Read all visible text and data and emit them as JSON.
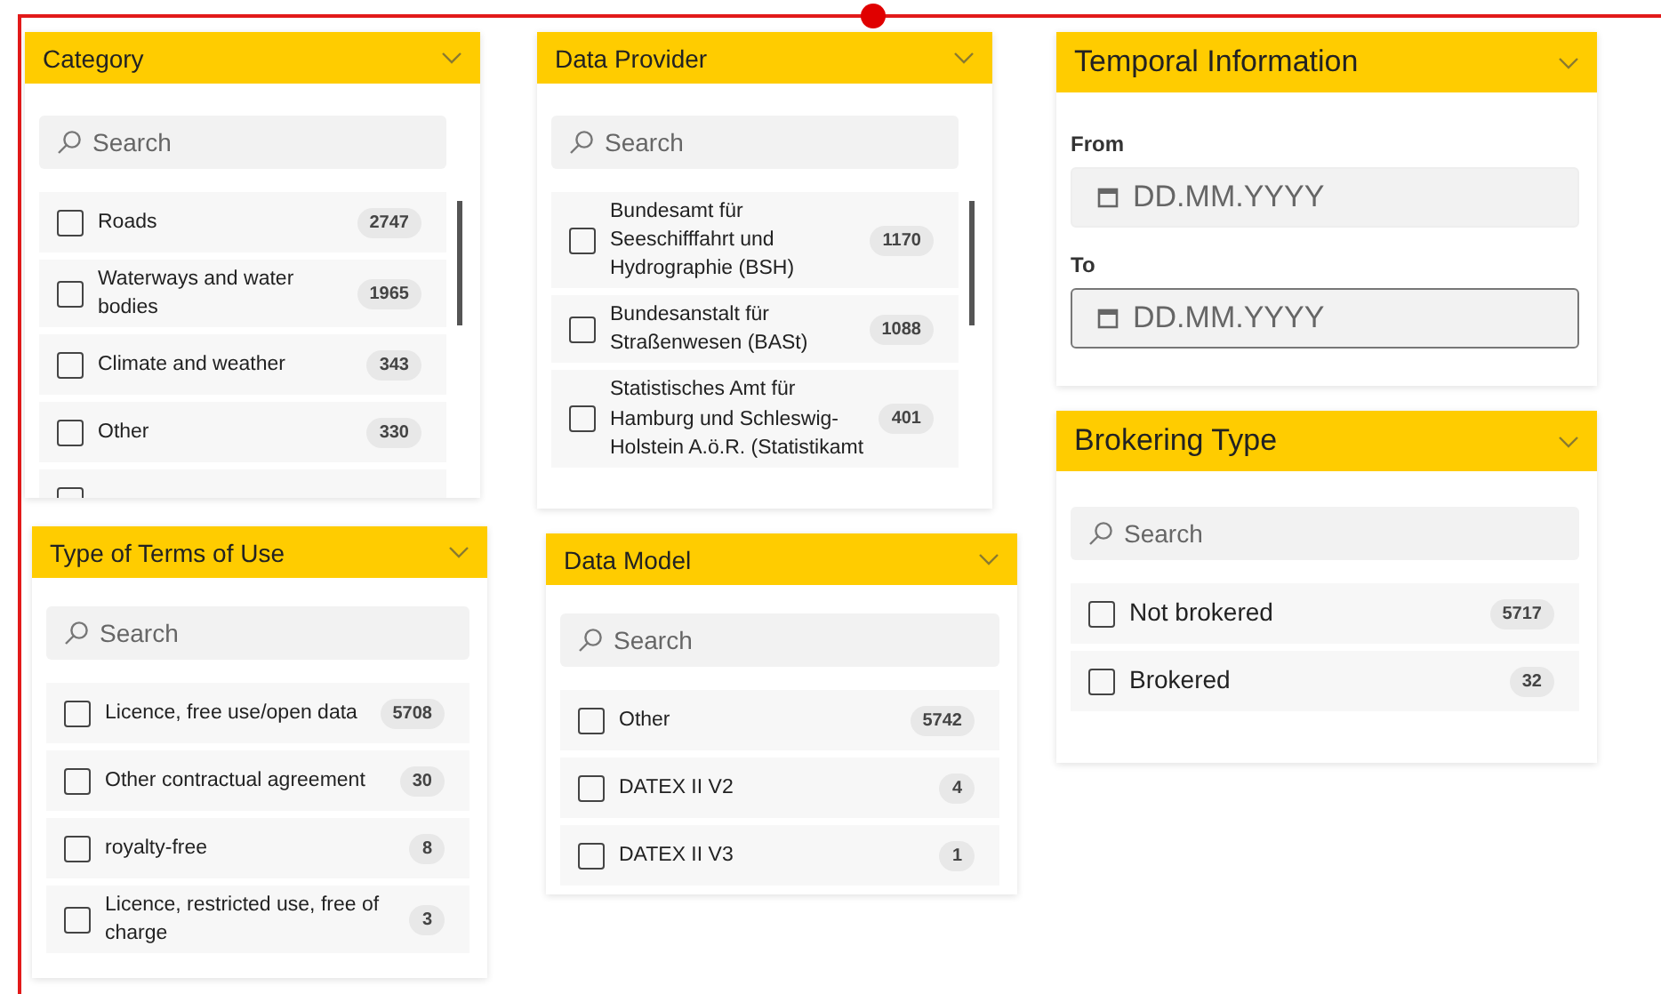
{
  "panels": [
    {
      "kind": "list",
      "title": "Category",
      "search": {
        "placeholder": "Search"
      },
      "items": [
        {
          "label": "Roads",
          "count": "2747",
          "checked": false
        },
        {
          "label": "Waterways and water bodies",
          "count": "1965",
          "checked": false
        },
        {
          "label": "Climate and weather",
          "count": "343",
          "checked": false
        },
        {
          "label": "Other",
          "count": "330",
          "checked": false
        },
        {
          "checked": false
        }
      ]
    },
    {
      "kind": "list",
      "title": "Data Provider",
      "search": {
        "placeholder": "Search"
      },
      "items": [
        {
          "label": "Bundesamt für Seeschifffahrt und Hydrographie (BSH)",
          "count": "1170",
          "checked": false
        },
        {
          "label": "Bundesanstalt für Straßenwesen (BASt)",
          "count": "1088",
          "checked": false
        },
        {
          "label": "Statistisches Amt für Hamburg und Schleswig-Holstein A.ö.R. (Statistikamt",
          "count": "401",
          "checked": false
        }
      ]
    },
    {
      "kind": "dates",
      "title": "Temporal Information",
      "fields": [
        {
          "label": "From",
          "placeholder": "DD.MM.YYYY",
          "focused": false
        },
        {
          "label": "To",
          "placeholder": "DD.MM.YYYY",
          "focused": true
        }
      ]
    },
    {
      "kind": "list",
      "title": "Type of Terms of Use",
      "search": {
        "placeholder": "Search"
      },
      "items": [
        {
          "label": "Licence, free use/open data",
          "count": "5708",
          "checked": false
        },
        {
          "label": "Other contractual agreement",
          "count": "30",
          "checked": false
        },
        {
          "label": "royalty-free",
          "count": "8",
          "checked": false
        },
        {
          "label": "Licence, restricted use, free of charge",
          "count": "3",
          "checked": false
        }
      ]
    },
    {
      "kind": "list",
      "title": "Data Model",
      "search": {
        "placeholder": "Search"
      },
      "items": [
        {
          "label": "Other",
          "count": "5742",
          "checked": false
        },
        {
          "label": "DATEX II V2",
          "count": "4",
          "checked": false
        },
        {
          "label": "DATEX II V3",
          "count": "1",
          "checked": false
        }
      ]
    },
    {
      "kind": "list",
      "title": "Brokering Type",
      "search": {
        "placeholder": "Search"
      },
      "items": [
        {
          "label": "Not brokered",
          "count": "5717",
          "checked": false
        },
        {
          "label": "Brokered",
          "count": "32",
          "checked": false
        }
      ]
    }
  ]
}
